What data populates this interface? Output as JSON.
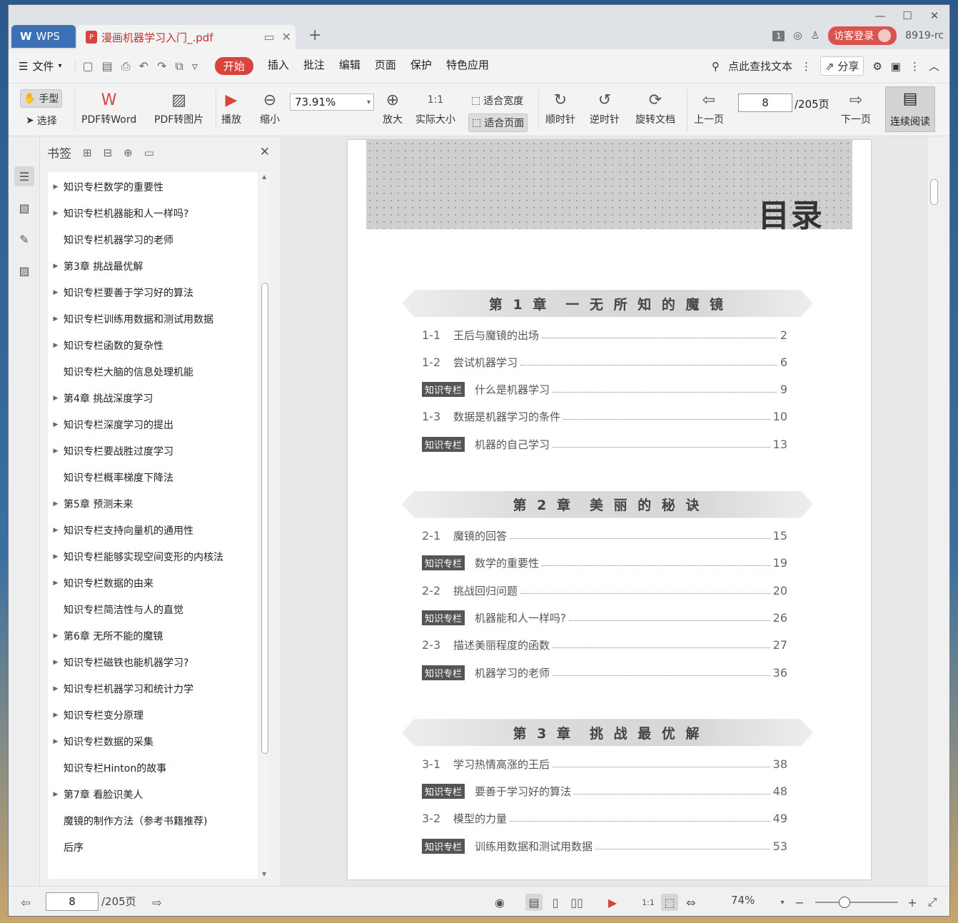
{
  "titlebar": {
    "app_tab": "WPS",
    "doc_tab": "漫画机器学习入门_.pdf",
    "page_badge": "1",
    "login": "访客登录",
    "user": "8919-rc"
  },
  "menu": {
    "file": "文件",
    "tabs": [
      "开始",
      "插入",
      "批注",
      "编辑",
      "页面",
      "保护",
      "特色应用"
    ],
    "search": "点此查找文本",
    "share": "分享"
  },
  "ribbon": {
    "hand": "手型",
    "select": "选择",
    "pdf_word": "PDF转Word",
    "pdf_image": "PDF转图片",
    "play": "播放",
    "zoom_out": "缩小",
    "zoom_value": "73.91%",
    "zoom_in": "放大",
    "actual_size": "实际大小",
    "fit_width": "适合宽度",
    "fit_page": "适合页面",
    "clockwise": "顺时针",
    "counterclockwise": "逆时针",
    "rotate_doc": "旋转文档",
    "prev_page": "上一页",
    "current_page": "8",
    "total_pages": "/205页",
    "next_page": "下一页",
    "continuous": "连续阅读"
  },
  "bookmarks": {
    "title": "书签",
    "items": [
      {
        "label": "知识专栏数学的重要性",
        "expandable": true
      },
      {
        "label": "知识专栏机器能和人一样吗?",
        "expandable": true
      },
      {
        "label": "知识专栏机器学习的老师",
        "expandable": false
      },
      {
        "label": "第3章 挑战最优解",
        "expandable": true
      },
      {
        "label": "知识专栏要善于学习好的算法",
        "expandable": true
      },
      {
        "label": "知识专栏训练用数据和测试用数据",
        "expandable": true
      },
      {
        "label": "知识专栏函数的复杂性",
        "expandable": true
      },
      {
        "label": "知识专栏大脑的信息处理机能",
        "expandable": false
      },
      {
        "label": "第4章 挑战深度学习",
        "expandable": true
      },
      {
        "label": "知识专栏深度学习的提出",
        "expandable": true
      },
      {
        "label": "知识专栏要战胜过度学习",
        "expandable": true
      },
      {
        "label": "知识专栏概率梯度下降法",
        "expandable": false
      },
      {
        "label": "第5章 预测未来",
        "expandable": true
      },
      {
        "label": "知识专栏支持向量机的通用性",
        "expandable": true
      },
      {
        "label": "知识专栏能够实现空间变形的内核法",
        "expandable": true
      },
      {
        "label": "知识专栏数据的由来",
        "expandable": true
      },
      {
        "label": "知识专栏简洁性与人的直觉",
        "expandable": false
      },
      {
        "label": "第6章 无所不能的魔镜",
        "expandable": true
      },
      {
        "label": "知识专栏磁铁也能机器学习?",
        "expandable": true
      },
      {
        "label": "知识专栏机器学习和统计力学",
        "expandable": true
      },
      {
        "label": "知识专栏变分原理",
        "expandable": true
      },
      {
        "label": "知识专栏数据的采集",
        "expandable": true
      },
      {
        "label": "知识专栏Hinton的故事",
        "expandable": false
      },
      {
        "label": "第7章 看脸识美人",
        "expandable": true
      },
      {
        "label": "魔镜的制作方法（参考书籍推荐)",
        "expandable": false
      },
      {
        "label": "后序",
        "expandable": false
      }
    ]
  },
  "page": {
    "title": "目录",
    "chapters": [
      {
        "heading": "第 1 章　一 无 所 知 的 魔 镜",
        "entries": [
          {
            "num": "1-1",
            "tag": "",
            "text": "王后与魔镜的出场",
            "page": "2"
          },
          {
            "num": "1-2",
            "tag": "",
            "text": "尝试机器学习",
            "page": "6"
          },
          {
            "num": "",
            "tag": "知识专栏",
            "text": "什么是机器学习",
            "page": "9"
          },
          {
            "num": "1-3",
            "tag": "",
            "text": "数据是机器学习的条件",
            "page": "10"
          },
          {
            "num": "",
            "tag": "知识专栏",
            "text": "机器的自己学习",
            "page": "13"
          }
        ]
      },
      {
        "heading": "第 2 章　美 丽 的 秘 诀",
        "entries": [
          {
            "num": "2-1",
            "tag": "",
            "text": "魔镜的回答",
            "page": "15"
          },
          {
            "num": "",
            "tag": "知识专栏",
            "text": "数学的重要性",
            "page": "19"
          },
          {
            "num": "2-2",
            "tag": "",
            "text": "挑战回归问题",
            "page": "20"
          },
          {
            "num": "",
            "tag": "知识专栏",
            "text": "机器能和人一样吗?",
            "page": "26"
          },
          {
            "num": "2-3",
            "tag": "",
            "text": "描述美丽程度的函数",
            "page": "27"
          },
          {
            "num": "",
            "tag": "知识专栏",
            "text": "机器学习的老师",
            "page": "36"
          }
        ]
      },
      {
        "heading": "第 3 章　挑 战 最 优 解",
        "entries": [
          {
            "num": "3-1",
            "tag": "",
            "text": "学习热情高涨的王后",
            "page": "38"
          },
          {
            "num": "",
            "tag": "知识专栏",
            "text": "要善于学习好的算法",
            "page": "48"
          },
          {
            "num": "3-2",
            "tag": "",
            "text": "模型的力量",
            "page": "49"
          },
          {
            "num": "",
            "tag": "知识专栏",
            "text": "训练用数据和测试用数据",
            "page": "53"
          }
        ]
      }
    ]
  },
  "status": {
    "current_page": "8",
    "total_pages": "/205页",
    "zoom": "74%",
    "zoom_fraction": 0.35
  }
}
